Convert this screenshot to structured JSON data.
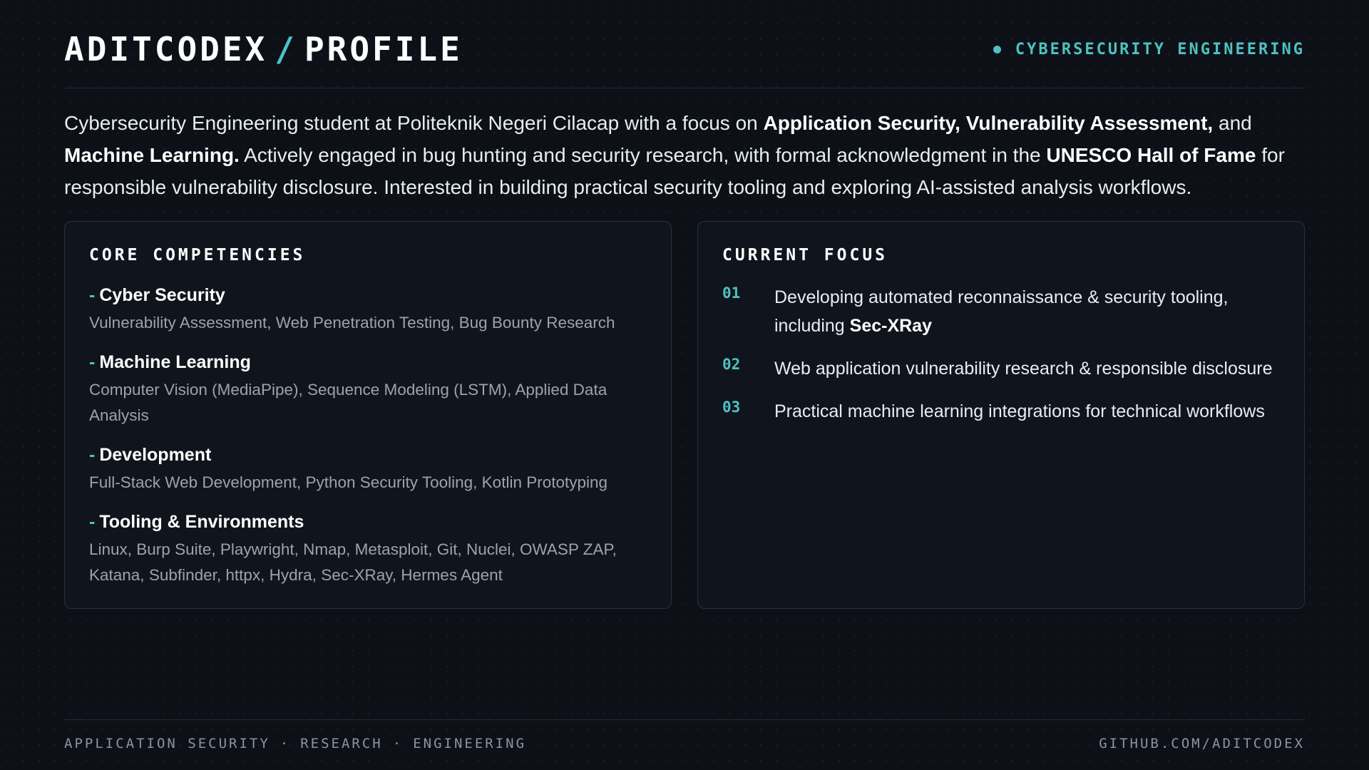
{
  "header": {
    "title_left": "ADITCODEX",
    "title_sep": "/",
    "title_right": "PROFILE",
    "tag": "CYBERSECURITY ENGINEERING"
  },
  "intro": {
    "p1": "Cybersecurity Engineering student at Politeknik Negeri Cilacap with a focus on ",
    "b1": "Application Security, Vulnerability Assessment,",
    "p2": " and ",
    "b2": "Machine Learning.",
    "p3": " Actively engaged in bug hunting and security research, with formal acknowledgment in the ",
    "b3": "UNESCO Hall of Fame",
    "p4": " for responsible vulnerability disclosure. Interested in building practical security tooling and exploring AI-assisted analysis workflows."
  },
  "competencies": {
    "title": "CORE COMPETENCIES",
    "dash": "-",
    "items": [
      {
        "name": "Cyber Security",
        "desc": "Vulnerability Assessment, Web Penetration Testing, Bug Bounty Research"
      },
      {
        "name": "Machine Learning",
        "desc": "Computer Vision (MediaPipe), Sequence Modeling (LSTM), Applied Data Analysis"
      },
      {
        "name": "Development",
        "desc": "Full-Stack Web Development, Python Security Tooling, Kotlin Prototyping"
      },
      {
        "name": "Tooling & Environments",
        "desc": "Linux, Burp Suite, Playwright, Nmap, Metasploit, Git, Nuclei, OWASP ZAP, Katana, Subfinder, httpx, Hydra, Sec-XRay, Hermes Agent"
      }
    ]
  },
  "focus": {
    "title": "CURRENT FOCUS",
    "items": [
      {
        "num": "01",
        "text": "Developing automated reconnaissance & security tooling, including ",
        "bold": "Sec-XRay"
      },
      {
        "num": "02",
        "text": "Web application vulnerability research & responsible disclosure",
        "bold": ""
      },
      {
        "num": "03",
        "text": "Practical machine learning integrations for technical workflows",
        "bold": ""
      }
    ]
  },
  "footer": {
    "left_parts": [
      "APPLICATION SECURITY",
      "RESEARCH",
      "ENGINEERING"
    ],
    "separator": "·",
    "right": "GITHUB.COM/ADITCODEX"
  },
  "colors": {
    "background": "#0d1117",
    "accent": "#4fc1c2",
    "card": "#10151d",
    "muted": "#9aa3ae"
  }
}
